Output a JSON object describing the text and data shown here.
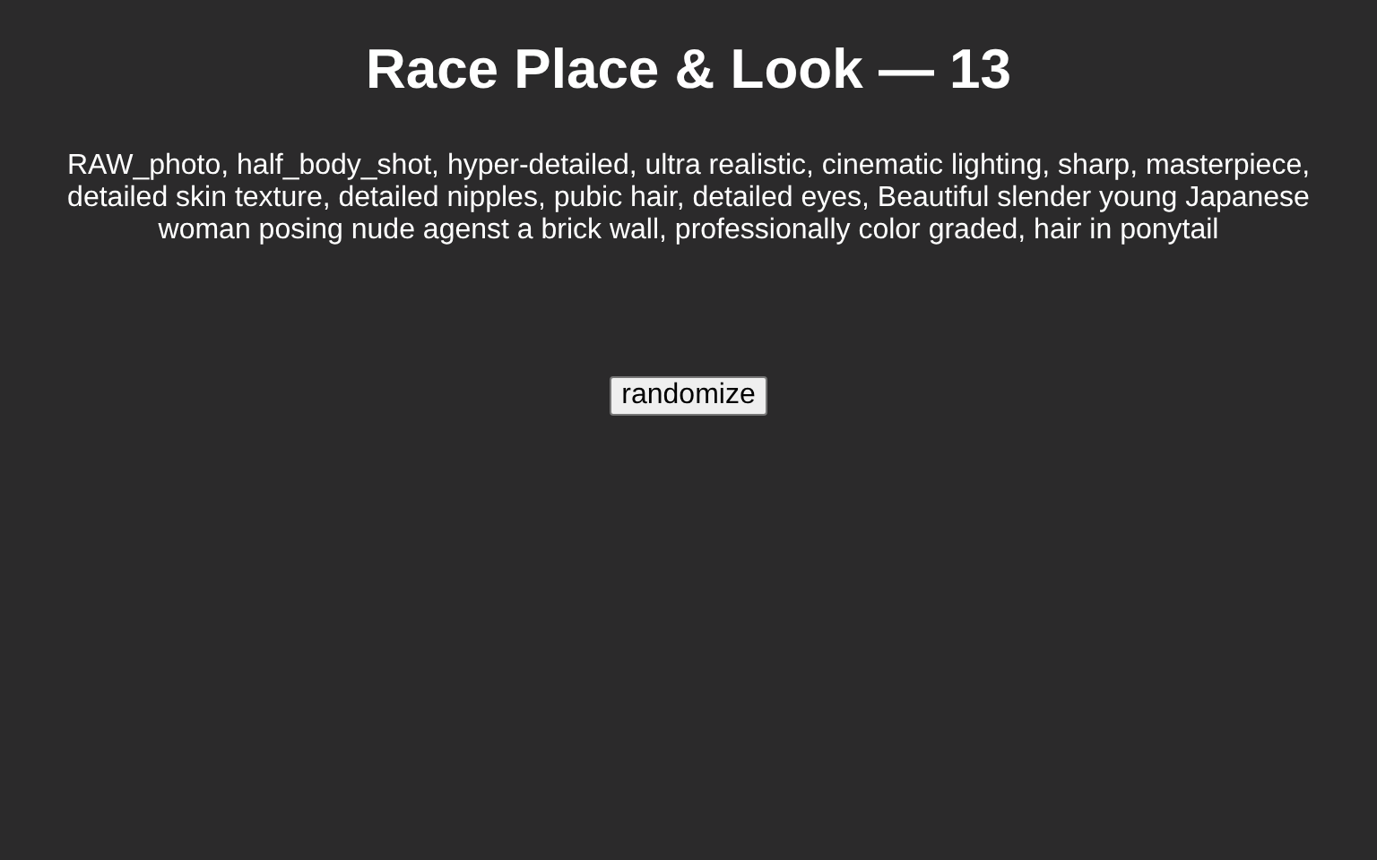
{
  "title": "Race Place & Look — 13",
  "prompt": "RAW_photo, half_body_shot, hyper-detailed, ultra realistic, cinematic lighting, sharp, masterpiece, detailed skin texture, detailed nipples, pubic hair, detailed eyes, Beautiful slender young Japanese woman posing nude agenst a brick wall, professionally color graded, hair in ponytail",
  "button": "randomize"
}
